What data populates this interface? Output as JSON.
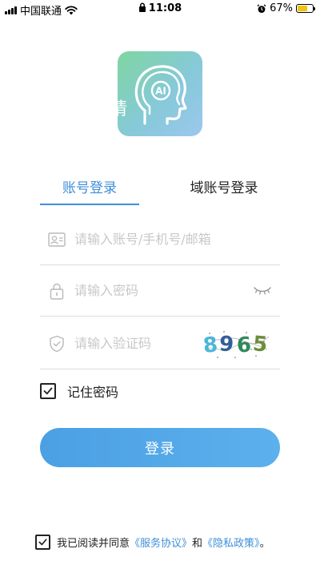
{
  "status_bar": {
    "carrier": "中国联通",
    "time": "11:08",
    "battery_percent": "67%",
    "battery_level": 0.67
  },
  "logo": {
    "badge_text": "AI",
    "clipped_char": "请"
  },
  "tabs": {
    "account": "账号登录",
    "domain": "域账号登录",
    "active": "account"
  },
  "form": {
    "account_placeholder": "请输入账号/手机号/邮箱",
    "account_value": "",
    "password_placeholder": "请输入密码",
    "password_value": "",
    "captcha_placeholder": "请输入验证码",
    "captcha_value": "",
    "captcha_image_text": "8965"
  },
  "remember": {
    "label": "记住密码",
    "checked": true
  },
  "login_button": "登录",
  "agreement": {
    "prefix": "我已阅读并同意",
    "service_link": "《服务协议》",
    "and": "和",
    "privacy_link": "《隐私政策》",
    "suffix": "。",
    "checked": true
  },
  "colors": {
    "accent": "#3e8fd8",
    "button": "#5aaeea",
    "logo_gradient_start": "#7fd6a1",
    "logo_gradient_end": "#9cc7ee"
  },
  "icons": {
    "account": "id-card-icon",
    "password": "lock-icon",
    "captcha": "shield-check-icon",
    "toggle_visibility": "eye-closed-icon"
  }
}
